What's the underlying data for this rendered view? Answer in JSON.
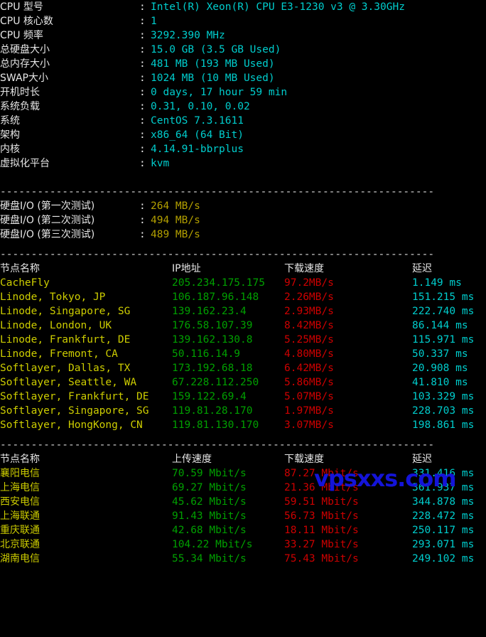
{
  "terminal": {
    "colors": {
      "background": "#000000",
      "white": "#e6e6e6",
      "cyan": "#00cdcd",
      "yellow": "#cdcd00",
      "dark_yellow": "#b3a000",
      "green": "#00a000",
      "red": "#cd0000",
      "separator": "#d8d8d8",
      "watermark": "#1414d8"
    },
    "separator_line": "----------------------------------------------------------------------",
    "colon": ":"
  },
  "watermark": {
    "text": "vpsxxs.com"
  },
  "sysinfo": {
    "rows": [
      {
        "label": "CPU 型号",
        "value": "Intel(R) Xeon(R) CPU E3-1230 v3 @ 3.30GHz"
      },
      {
        "label": "CPU 核心数",
        "value": "1"
      },
      {
        "label": "CPU 频率",
        "value": "3292.390 MHz"
      },
      {
        "label": "总硬盘大小",
        "value": "15.0 GB (3.5 GB Used)"
      },
      {
        "label": "总内存大小",
        "value": "481 MB (193 MB Used)"
      },
      {
        "label": "SWAP大小",
        "value": "1024 MB (10 MB Used)"
      },
      {
        "label": "开机时长",
        "value": "0 days, 17 hour 59 min"
      },
      {
        "label": "系统负载",
        "value": "0.31, 0.10, 0.02"
      },
      {
        "label": "系统",
        "value": "CentOS 7.3.1611"
      },
      {
        "label": "架构",
        "value": "x86_64 (64 Bit)"
      },
      {
        "label": "内核",
        "value": "4.14.91-bbrplus"
      },
      {
        "label": "虚拟化平台",
        "value": "kvm"
      }
    ]
  },
  "diskio": {
    "rows": [
      {
        "label": "硬盘I/O (第一次测试)",
        "value": "264 MB/s"
      },
      {
        "label": "硬盘I/O (第二次测试)",
        "value": "494 MB/s"
      },
      {
        "label": "硬盘I/O (第三次测试)",
        "value": "489 MB/s"
      }
    ]
  },
  "node_table": {
    "headers": {
      "name": "节点名称",
      "ip": "IP地址",
      "download": "下载速度",
      "latency": "延迟"
    },
    "rows": [
      {
        "name": "CacheFly",
        "ip": "205.234.175.175",
        "download": "97.2MB/s",
        "latency": "1.149 ms"
      },
      {
        "name": "Linode, Tokyo, JP",
        "ip": "106.187.96.148",
        "download": "2.26MB/s",
        "latency": "151.215 ms"
      },
      {
        "name": "Linode, Singapore, SG",
        "ip": "139.162.23.4",
        "download": "2.93MB/s",
        "latency": "222.740 ms"
      },
      {
        "name": "Linode, London, UK",
        "ip": "176.58.107.39",
        "download": "8.42MB/s",
        "latency": "86.144 ms"
      },
      {
        "name": "Linode, Frankfurt, DE",
        "ip": "139.162.130.8",
        "download": "5.25MB/s",
        "latency": "115.971 ms"
      },
      {
        "name": "Linode, Fremont, CA",
        "ip": "50.116.14.9",
        "download": "4.80MB/s",
        "latency": "50.337 ms"
      },
      {
        "name": "Softlayer, Dallas, TX",
        "ip": "173.192.68.18",
        "download": "6.42MB/s",
        "latency": "20.908 ms"
      },
      {
        "name": "Softlayer, Seattle, WA",
        "ip": "67.228.112.250",
        "download": "5.86MB/s",
        "latency": "41.810 ms"
      },
      {
        "name": "Softlayer, Frankfurt, DE",
        "ip": "159.122.69.4",
        "download": "5.07MB/s",
        "latency": "103.329 ms"
      },
      {
        "name": "Softlayer, Singapore, SG",
        "ip": "119.81.28.170",
        "download": "1.97MB/s",
        "latency": "228.703 ms"
      },
      {
        "name": "Softlayer, HongKong, CN",
        "ip": "119.81.130.170",
        "download": "3.07MB/s",
        "latency": "198.861 ms"
      }
    ]
  },
  "speedtest_table": {
    "headers": {
      "name": "节点名称",
      "upload": "上传速度",
      "download": "下载速度",
      "latency": "延迟"
    },
    "rows": [
      {
        "name": "襄阳电信",
        "upload": "70.59 Mbit/s",
        "download": "87.27 Mbit/s",
        "latency": "331.416 ms"
      },
      {
        "name": "上海电信",
        "upload": "69.27 Mbit/s",
        "download": "21.36 Mbit/s",
        "latency": "361.937 ms"
      },
      {
        "name": "西安电信",
        "upload": "45.62 Mbit/s",
        "download": "59.51 Mbit/s",
        "latency": "344.878 ms"
      },
      {
        "name": "上海联通",
        "upload": "91.43 Mbit/s",
        "download": "56.73 Mbit/s",
        "latency": "228.472 ms"
      },
      {
        "name": "重庆联通",
        "upload": "42.68 Mbit/s",
        "download": "18.11 Mbit/s",
        "latency": "250.117 ms"
      },
      {
        "name": "北京联通",
        "upload": "104.22 Mbit/s",
        "download": "33.27 Mbit/s",
        "latency": "293.071 ms"
      },
      {
        "name": "湖南电信",
        "upload": "55.34 Mbit/s",
        "download": "75.43 Mbit/s",
        "latency": "249.102 ms"
      }
    ]
  }
}
